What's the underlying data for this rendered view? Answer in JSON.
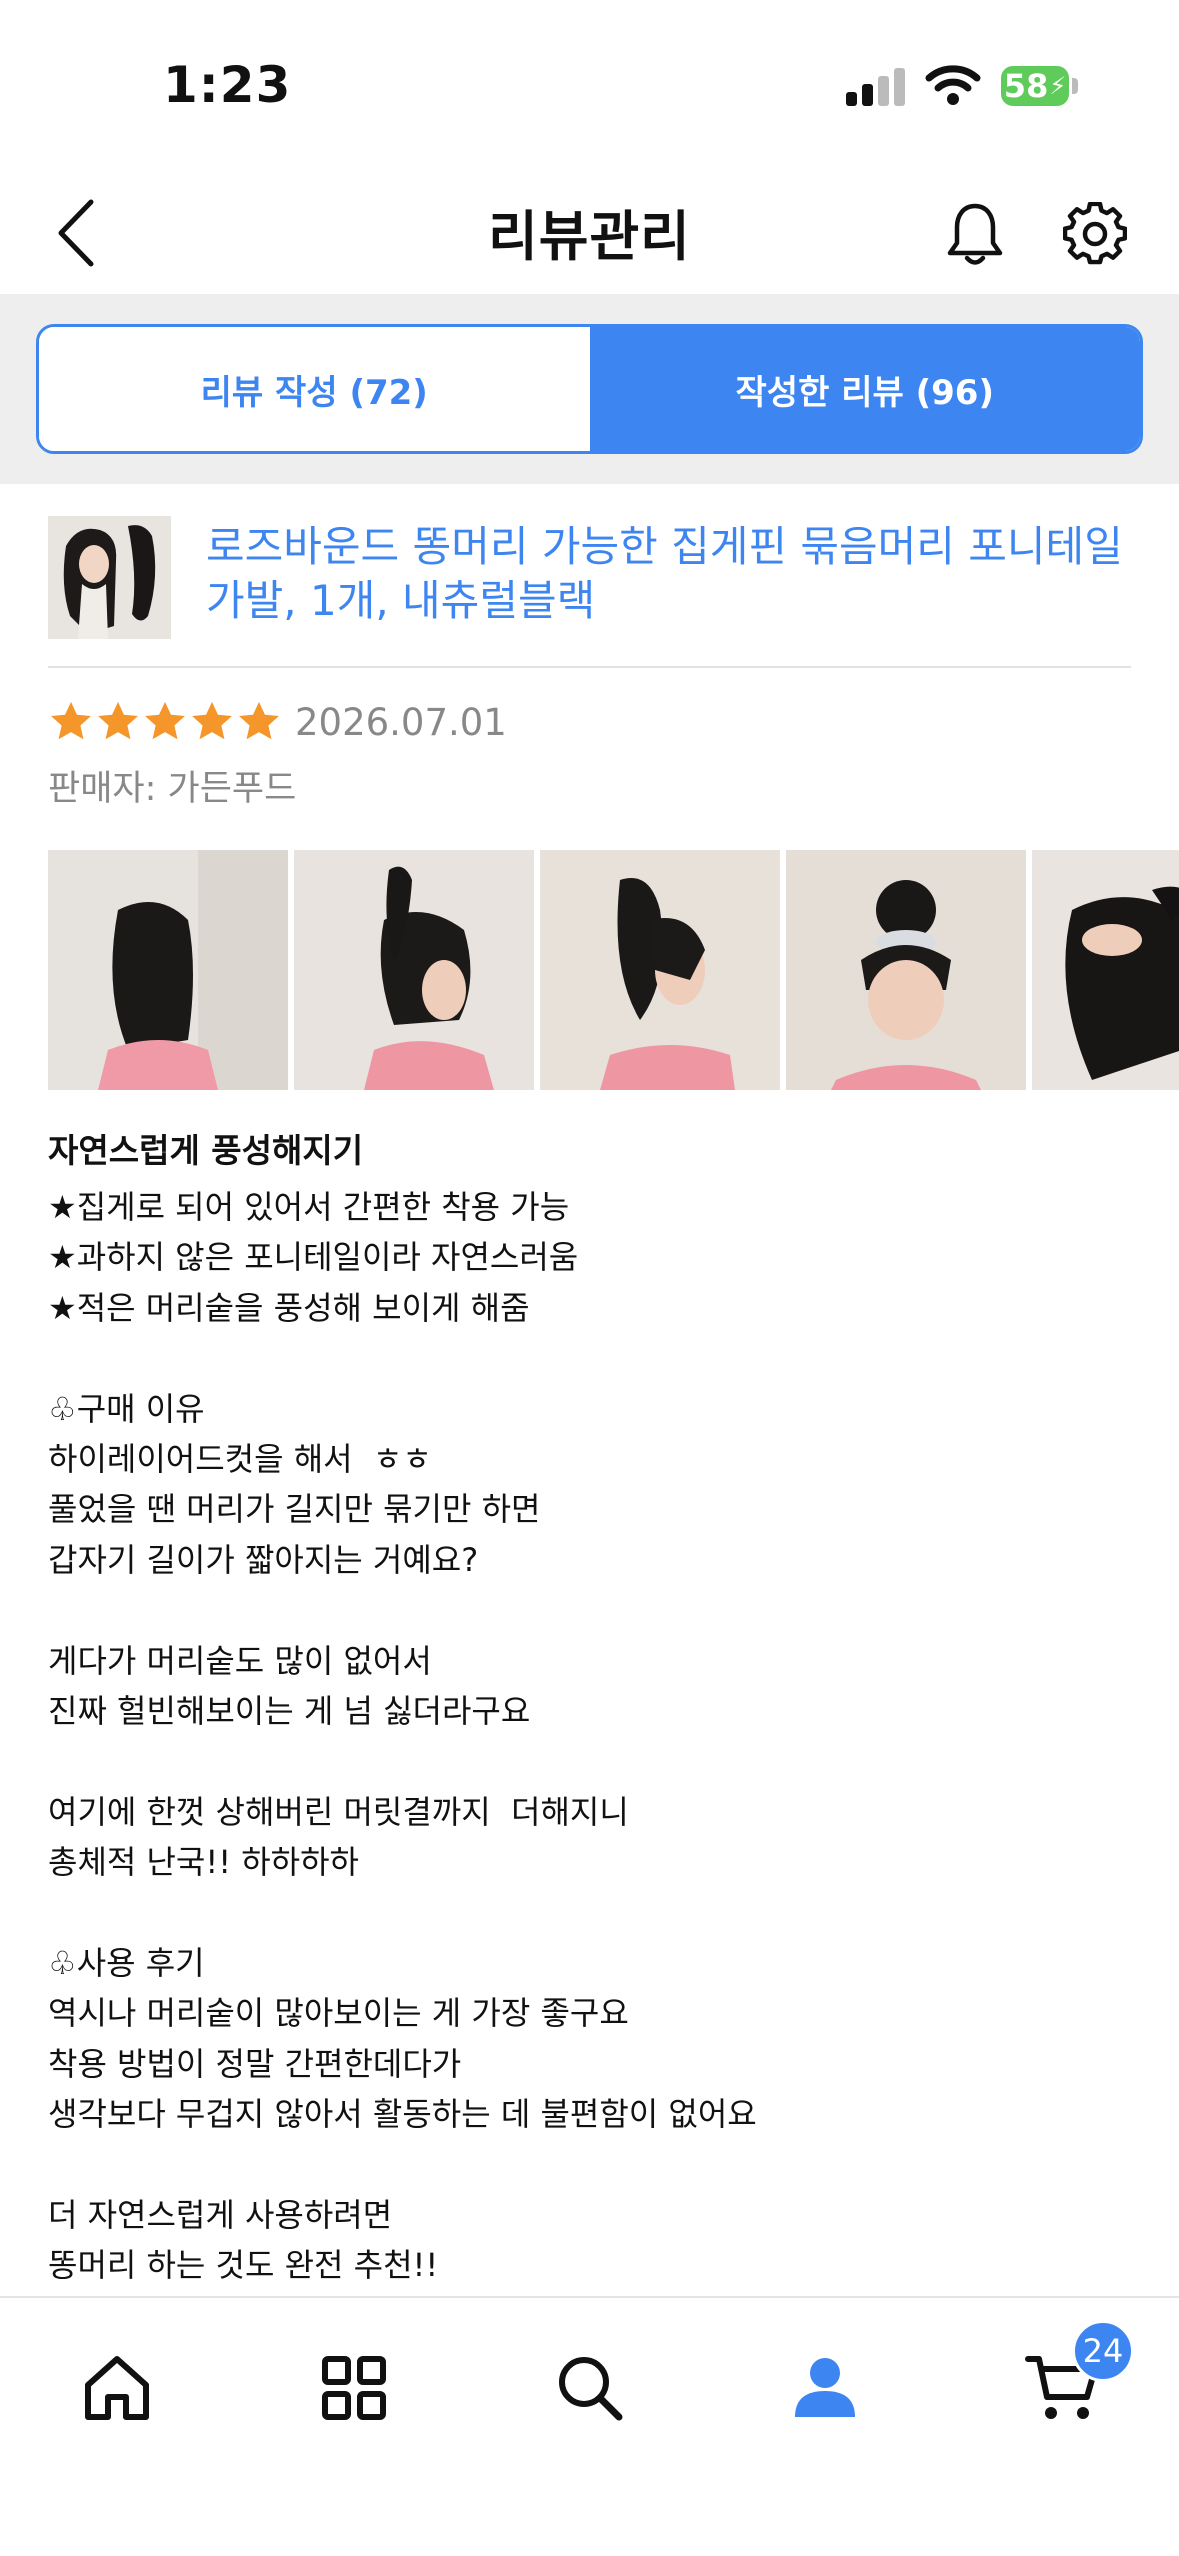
{
  "status_bar": {
    "time": "1:23",
    "battery": "58"
  },
  "header": {
    "title": "리뷰관리"
  },
  "tabs": [
    {
      "label": "리뷰 작성 (72)",
      "active": false
    },
    {
      "label": "작성한 리뷰 (96)",
      "active": true
    }
  ],
  "product": {
    "name": "로즈바운드 똥머리 가능한 집게핀 묶음머리 포니테일 가발, 1개, 내츄럴블랙"
  },
  "review": {
    "rating": 5,
    "date": "2026.07.01",
    "seller": "판매자: 가든푸드",
    "title": "자연스럽게 풍성해지기",
    "lines": [
      "★집게로 되어 있어서 간편한 착용 가능",
      "★과하지 않은 포니테일이라 자연스러움",
      "★적은 머리숱을 풍성해 보이게 해줌",
      "",
      "♧구매 이유",
      "하이레이어드컷을 해서  ㅎㅎ",
      "풀었을 땐 머리가 길지만 묶기만 하면",
      "갑자기 길이가 짧아지는 거예요?",
      "",
      "게다가 머리숱도 많이 없어서",
      "진짜 헐빈해보이는 게 넘 싫더라구요",
      "",
      "여기에 한껏 상해버린 머릿결까지  더해지니",
      "총체적 난국!! 하하하하",
      "",
      "♧사용 후기",
      "역시나 머리숱이 많아보이는 게 가장 좋구요",
      "착용 방법이 정말 간편한데다가",
      "생각보다 무겁지 않아서 활동하는 데 불편함이 없어요",
      "",
      "더 자연스럽게 사용하려면",
      "똥머리 하는 것도 완전 추천!!"
    ]
  },
  "bottom_nav": {
    "cart_badge": "24"
  },
  "colors": {
    "accent": "#3d85f0",
    "star": "#f5962b",
    "muted": "#888888"
  }
}
